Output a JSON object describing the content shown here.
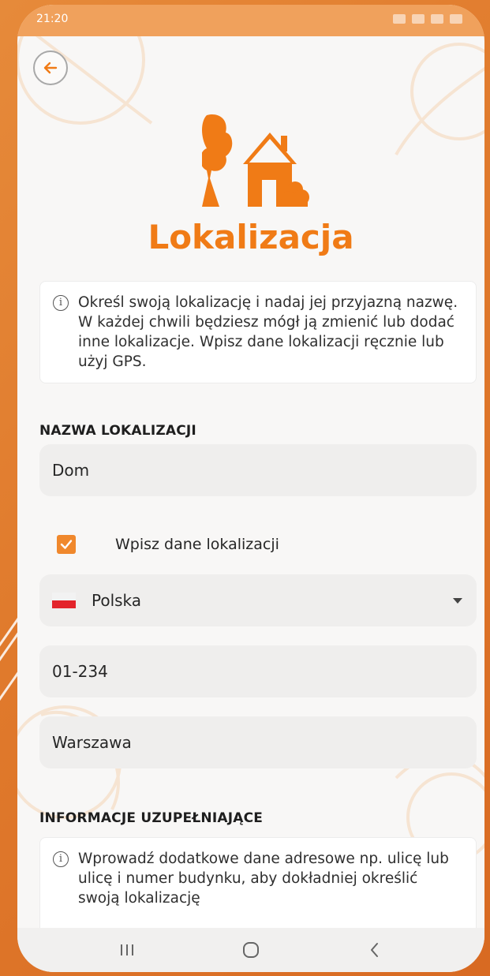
{
  "status_bar": {
    "time": "21:20"
  },
  "header": {
    "back_icon": "arrow-left-icon",
    "hero_icon": "house-with-trees-icon",
    "title": "Lokalizacja"
  },
  "info": {
    "icon": "info-circle-icon",
    "text": "Określ swoją lokalizację i nadaj jej przyjazną nazwę. W każdej chwili będziesz mógł ją zmienić lub dodać inne lokalizacje. Wpisz dane lokalizacji ręcznie lub użyj GPS."
  },
  "location_name": {
    "label": "NAZWA LOKALIZACJI",
    "value": "Dom"
  },
  "manual_entry": {
    "checked": true,
    "label": "Wpisz dane lokalizacji"
  },
  "country_select": {
    "flag": "poland-flag-icon",
    "value": "Polska"
  },
  "postal_code": {
    "value": "01-234"
  },
  "city": {
    "value": "Warszawa"
  },
  "additional_info": {
    "label": "INFORMACJE UZUPEŁNIAJĄCE",
    "icon": "info-circle-icon",
    "text": "Wprowadź dodatkowe dane adresowe np. ulicę lub ulicę i numer budynku, aby dokładniej określić swoją lokalizację"
  },
  "nav_bar": {
    "recents_icon": "recent-apps-icon",
    "home_icon": "home-circle-icon",
    "back_icon": "chevron-left-icon"
  },
  "colors": {
    "accent": "#f07b16",
    "checkbox": "#f0882c",
    "frame": "#e07a2c"
  }
}
